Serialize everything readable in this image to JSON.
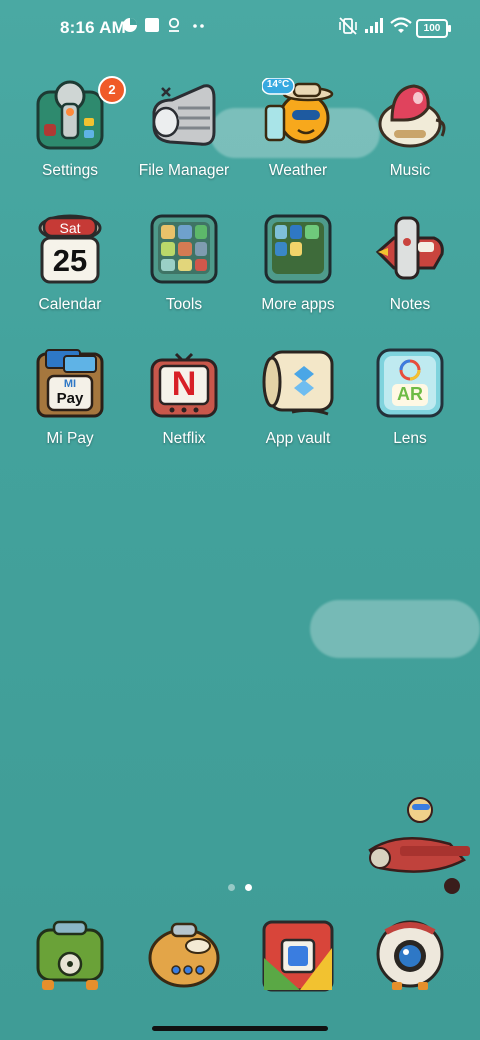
{
  "status_bar": {
    "time": "8:16 AM",
    "battery": "100",
    "icons": [
      "data-saver-icon",
      "square-notification-icon",
      "location-icon",
      "more-dots-icon",
      "vibrate-icon",
      "signal-icon",
      "wifi-icon",
      "battery-icon"
    ]
  },
  "apps": [
    {
      "label": "Settings",
      "badge": "2",
      "icon": "settings-icon"
    },
    {
      "label": "File Manager",
      "icon": "file-manager-icon"
    },
    {
      "label": "Weather",
      "icon": "weather-icon",
      "temperature": "14°C"
    },
    {
      "label": "Music",
      "icon": "music-icon"
    },
    {
      "label": "Calendar",
      "icon": "calendar-icon",
      "day_name": "Sat",
      "day_number": "25"
    },
    {
      "label": "Tools",
      "icon": "tools-folder-icon"
    },
    {
      "label": "More apps",
      "icon": "more-apps-folder-icon"
    },
    {
      "label": "Notes",
      "icon": "notes-icon"
    },
    {
      "label": "Mi Pay",
      "icon": "mi-pay-icon",
      "icon_text_top": "MI",
      "icon_text_bottom": "Pay"
    },
    {
      "label": "Netflix",
      "icon": "netflix-icon",
      "icon_letter": "N"
    },
    {
      "label": "App vault",
      "icon": "app-vault-icon"
    },
    {
      "label": "Lens",
      "icon": "lens-icon",
      "icon_text": "AR"
    }
  ],
  "page_indicator": {
    "count": 2,
    "active": 2
  },
  "dock": [
    {
      "icon": "phone-robot-icon"
    },
    {
      "icon": "messages-submarine-icon"
    },
    {
      "icon": "chrome-icon"
    },
    {
      "icon": "camera-robot-icon"
    }
  ]
}
